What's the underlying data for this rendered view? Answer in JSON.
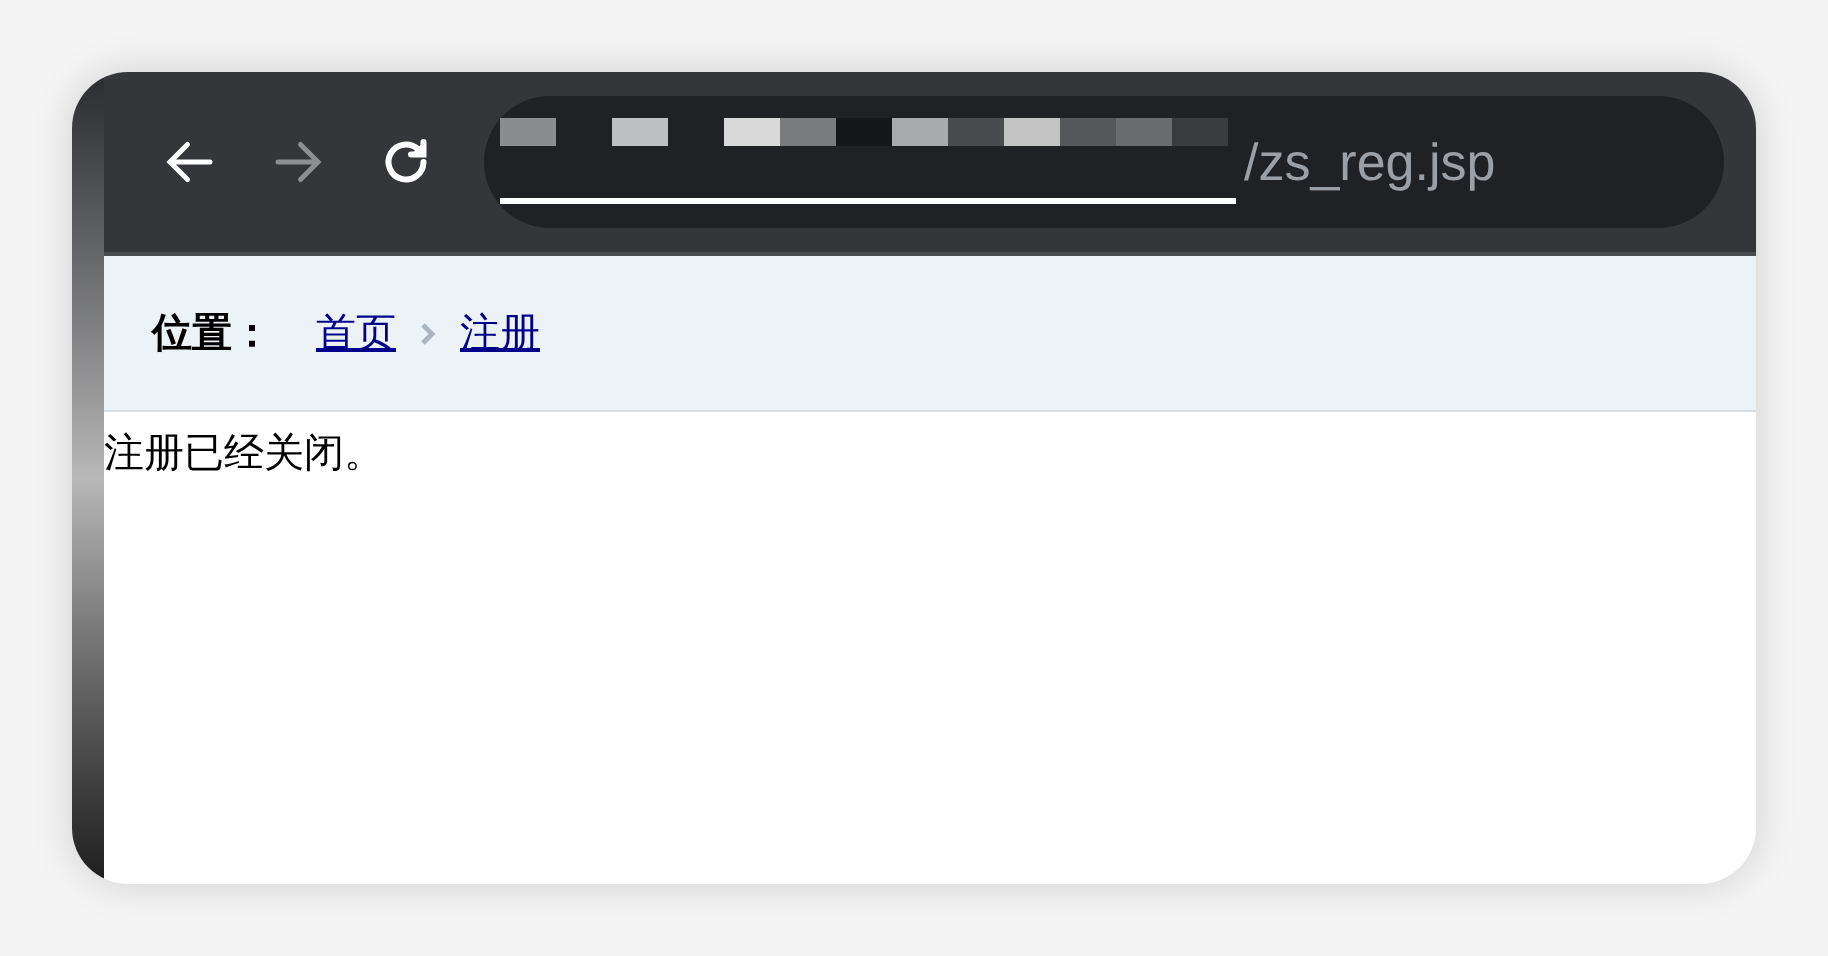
{
  "browser": {
    "url": "/zs_reg.jsp"
  },
  "breadcrumb": {
    "label": "位置：",
    "items": [
      {
        "text": "首页"
      },
      {
        "text": "注册"
      }
    ]
  },
  "message": "注册已经关闭。"
}
